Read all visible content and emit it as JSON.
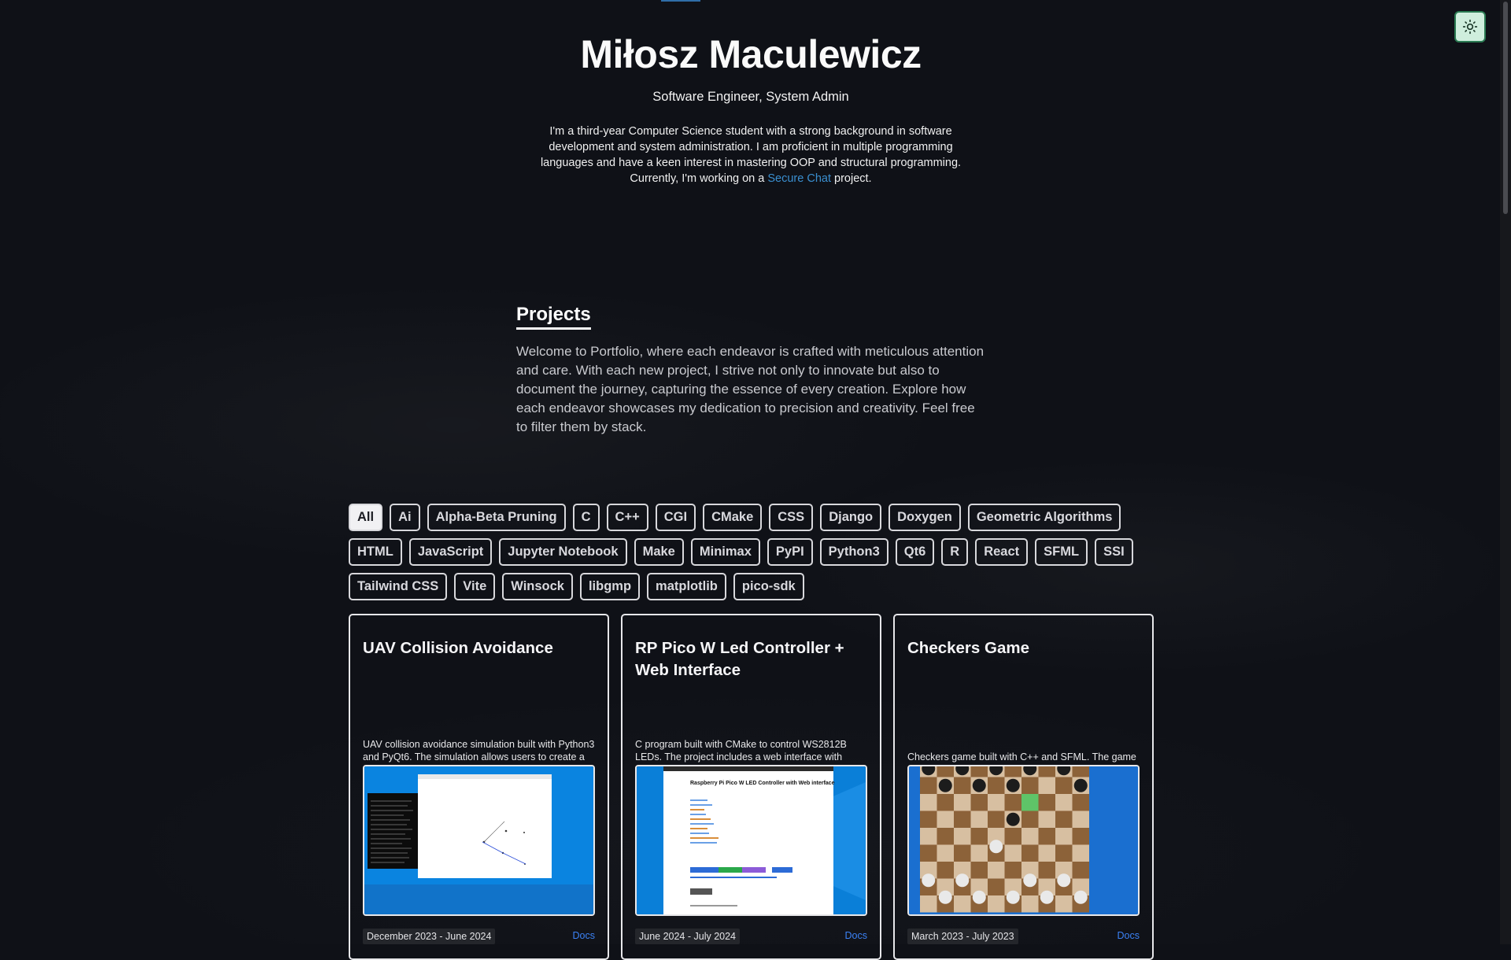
{
  "theme_icon": "sun-icon",
  "hero": {
    "name": "Miłosz Maculewicz",
    "subtitle": "Software Engineer, System Admin",
    "bio_before": "I'm a third-year Computer Science student with a strong background in software development and system administration. I am proficient in multiple programming languages and have a keen interest in mastering OOP and structural programming. Currently, I'm working on a ",
    "bio_link": "Secure Chat",
    "bio_after": " project."
  },
  "projects": {
    "heading": "Projects",
    "intro": "Welcome to Portfolio, where each endeavor is crafted with meticulous attention and care. With each new project, I strive not only to innovate but also to document the journey, capturing the essence of every creation. Explore how each endeavor showcases my dedication to precision and creativity. Feel free to filter them by stack."
  },
  "filters": [
    "All",
    "Ai",
    "Alpha-Beta Pruning",
    "C",
    "C++",
    "CGI",
    "CMake",
    "CSS",
    "Django",
    "Doxygen",
    "Geometric Algorithms",
    "HTML",
    "JavaScript",
    "Jupyter Notebook",
    "Make",
    "Minimax",
    "PyPI",
    "Python3",
    "Qt6",
    "R",
    "React",
    "SFML",
    "SSI",
    "Tailwind CSS",
    "Vite",
    "Winsock",
    "libgmp",
    "matplotlib",
    "pico-sdk"
  ],
  "active_filter": "All",
  "cards": [
    {
      "title": "UAV Collision Avoidance",
      "description": "UAV collision avoidance simulation built with Python3 and PyQt6. The simulation allows users to create a custom environment and test different test cases while using geometric approach to avoid collisions. The simulation is part of my Bachelor's thesis.",
      "date": "December 2023 - June 2024",
      "docs_label": "Docs"
    },
    {
      "title": "RP Pico W Led Controller + Web Interface",
      "description": "C program built with CMake to control WS2812B LEDs. The project includes a web interface with predefined light modes, it is based on HTML/JavaScript using CGI and SSI to communicate with Pico.",
      "date": "June 2024 - July 2024",
      "docs_label": "Docs",
      "screenshot_title": "Raspberry Pi Pico W LED Controller with Web interface"
    },
    {
      "title": "Checkers Game",
      "description": "Checkers game built with C++ and SFML. The game allows players to play against each other or against a bot using the minimax algorithm with alpha-beta pruning to make decisions.",
      "date": "March 2023 - July 2023",
      "docs_label": "Docs"
    }
  ]
}
